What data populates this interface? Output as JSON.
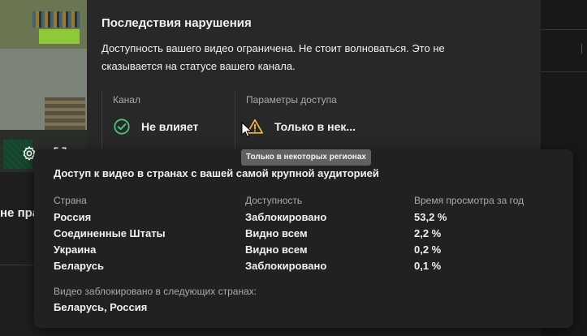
{
  "background": {
    "partial_title": "не прав"
  },
  "dialog": {
    "title": "Последствия нарушения",
    "description": "Доступность вашего видео ограничена. Не стоит волноваться. Это не сказывается на статусе вашего канала.",
    "channel": {
      "label": "Канал",
      "value": "Не влияет",
      "icon": "check-circle-icon",
      "color": "#4ec27a"
    },
    "access": {
      "label": "Параметры доступа",
      "value": "Только в нек...",
      "icon": "warning-icon",
      "color": "#f6b94b"
    },
    "tooltip": "Только в некоторых регионах"
  },
  "audience_card": {
    "heading": "Доступ к видео в странах с вашей самой крупной аудиторией",
    "columns": [
      "Страна",
      "Доступность",
      "Время просмотра за год"
    ],
    "rows": [
      [
        "Россия",
        "Заблокировано",
        "53,2 %"
      ],
      [
        "Соединенные Штаты",
        "Видно всем",
        "2,2 %"
      ],
      [
        "Украина",
        "Видно всем",
        "0,2 %"
      ],
      [
        "Беларусь",
        "Заблокировано",
        "0,1 %"
      ]
    ],
    "blocked_label": "Видео заблокировано в следующих странах:",
    "blocked_countries": "Беларусь, Россия"
  }
}
